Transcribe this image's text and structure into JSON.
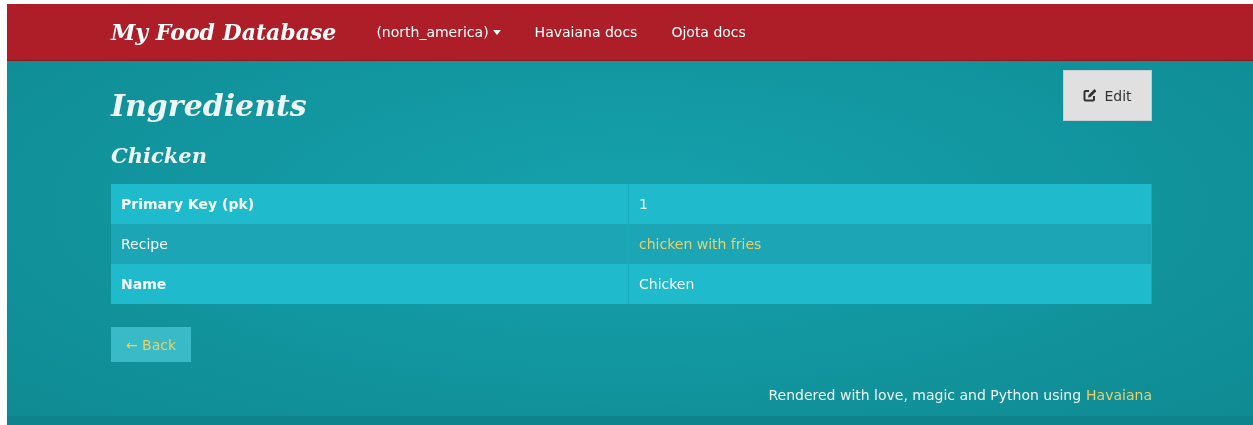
{
  "navbar": {
    "brand": "My Food Database",
    "items": [
      {
        "label": "(north_america)",
        "kind": "dropdown"
      },
      {
        "label": "Havaiana docs",
        "kind": "link"
      },
      {
        "label": "Ojota docs",
        "kind": "link"
      }
    ]
  },
  "page_title": "Ingredients",
  "edit_button": "Edit",
  "record_title": "Chicken",
  "rows": [
    {
      "label": "Primary Key (pk)",
      "bold": true,
      "value": "1",
      "kind": "text"
    },
    {
      "label": "Recipe",
      "bold": false,
      "value": "chicken with fries",
      "kind": "link"
    },
    {
      "label": "Name",
      "bold": true,
      "value": "Chicken",
      "kind": "text"
    }
  ],
  "back_button": "← Back",
  "footer": {
    "text": "Rendered with love, magic and Python using",
    "link": "Havaiana"
  }
}
